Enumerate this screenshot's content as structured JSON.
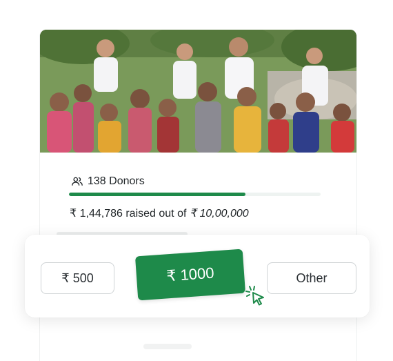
{
  "donation_card": {
    "photo_alt": "",
    "donors": {
      "icon": "users-icon",
      "label": "138 Donors"
    },
    "progress": {
      "raised_fraction": 0.7,
      "color": "#1e8a4a"
    },
    "raised": {
      "prefix": "₹ 1,44,786 raised out of",
      "goal": "₹ 10,00,000"
    }
  },
  "amount_selector": {
    "options": [
      {
        "label": "₹ 500",
        "selected": false
      },
      {
        "label": "₹ 1000",
        "selected": true
      },
      {
        "label": "Other",
        "selected": false
      }
    ],
    "accent": "#1e8a4a",
    "cursor_icon": "click-pointer-icon"
  }
}
